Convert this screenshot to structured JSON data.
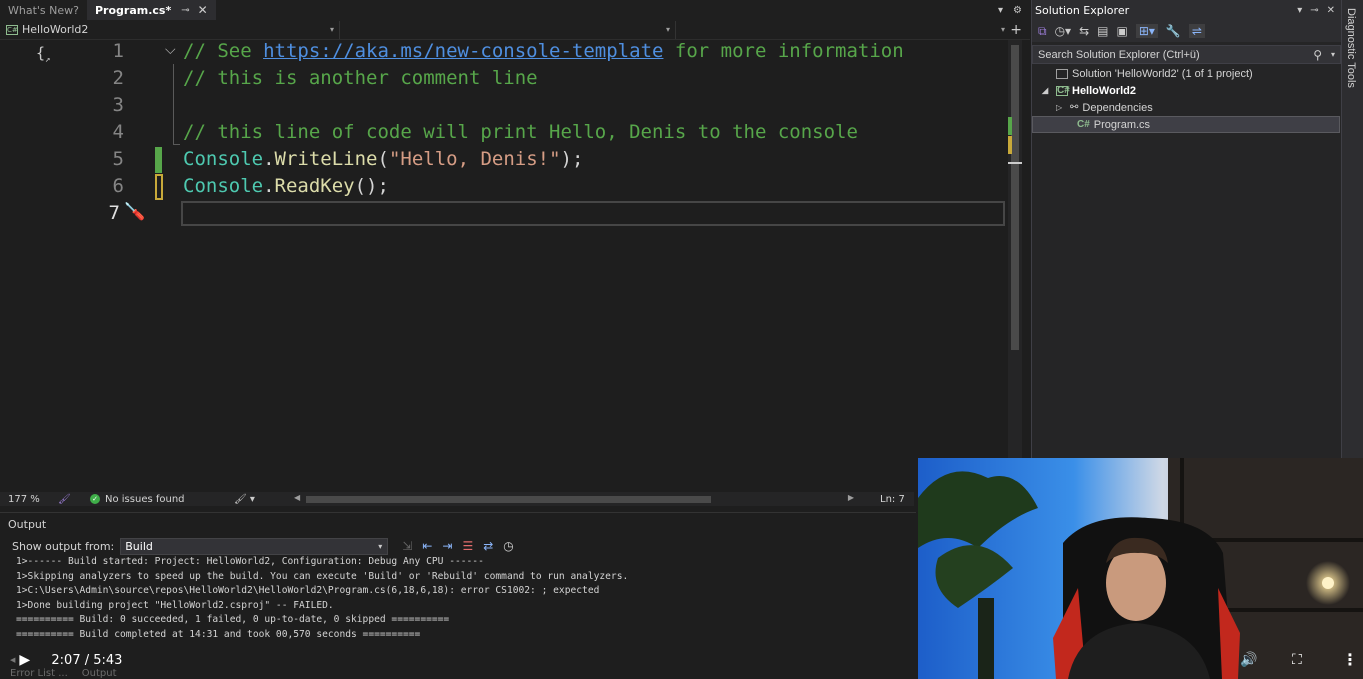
{
  "tabs": [
    {
      "label": "What's New?",
      "active": false
    },
    {
      "label": "Program.cs*",
      "active": true,
      "pin_icon": "pin-icon",
      "close_icon": "close-icon"
    }
  ],
  "navbar": {
    "project_combo": "HelloWorld2",
    "type_combo": "",
    "member_combo": ""
  },
  "editor": {
    "line_numbers": [
      "1",
      "2",
      "3",
      "4",
      "5",
      "6",
      "7"
    ],
    "lines": {
      "l1_pre": "// See ",
      "l1_link": "https://aka.ms/new-console-template",
      "l1_post": " for more information",
      "l2": "// this is another comment line",
      "l4": "// this line of code will print Hello, Denis to the console",
      "l5_class": "Console",
      "l5_dot": ".",
      "l5_method": "WriteLine",
      "l5_open": "(",
      "l5_string": "\"Hello, Denis!\"",
      "l5_close": ");",
      "l6_class": "Console",
      "l6_dot": ".",
      "l6_method": "ReadKey",
      "l6_close": "();"
    },
    "colors": {
      "comment": "#57a64a",
      "link": "#4f8fe0",
      "class": "#4ec9b0",
      "method": "#dcdcaa",
      "string": "#d69d85"
    }
  },
  "status": {
    "zoom": "177 %",
    "issues": "No issues found",
    "line": "Ln: 7"
  },
  "output": {
    "title": "Output",
    "show_from_label": "Show output from:",
    "source": "Build",
    "lines": [
      "1>------ Build started: Project: HelloWorld2, Configuration: Debug Any CPU ------",
      "1>Skipping analyzers to speed up the build. You can execute 'Build' or 'Rebuild' command to run analyzers.",
      "1>C:\\Users\\Admin\\source\\repos\\HelloWorld2\\HelloWorld2\\Program.cs(6,18,6,18): error CS1002: ; expected",
      "1>Done building project \"HelloWorld2.csproj\" -- FAILED.",
      "========== Build: 0 succeeded, 1 failed, 0 up-to-date, 0 skipped ==========",
      "========== Build completed at 14:31 and took 00,570 seconds =========="
    ]
  },
  "bottom_tabs": [
    "Error List ...",
    "Output"
  ],
  "video": {
    "time": "2:07 / 5:43"
  },
  "solution_explorer": {
    "title": "Solution Explorer",
    "search_placeholder": "Search Solution Explorer (Ctrl+ü)",
    "solution": "Solution 'HelloWorld2' (1 of 1 project)",
    "project": "HelloWorld2",
    "dependencies": "Dependencies",
    "file": "Program.cs",
    "file_icon_text": "C#"
  },
  "side_tab": {
    "label": "Diagnostic Tools"
  }
}
